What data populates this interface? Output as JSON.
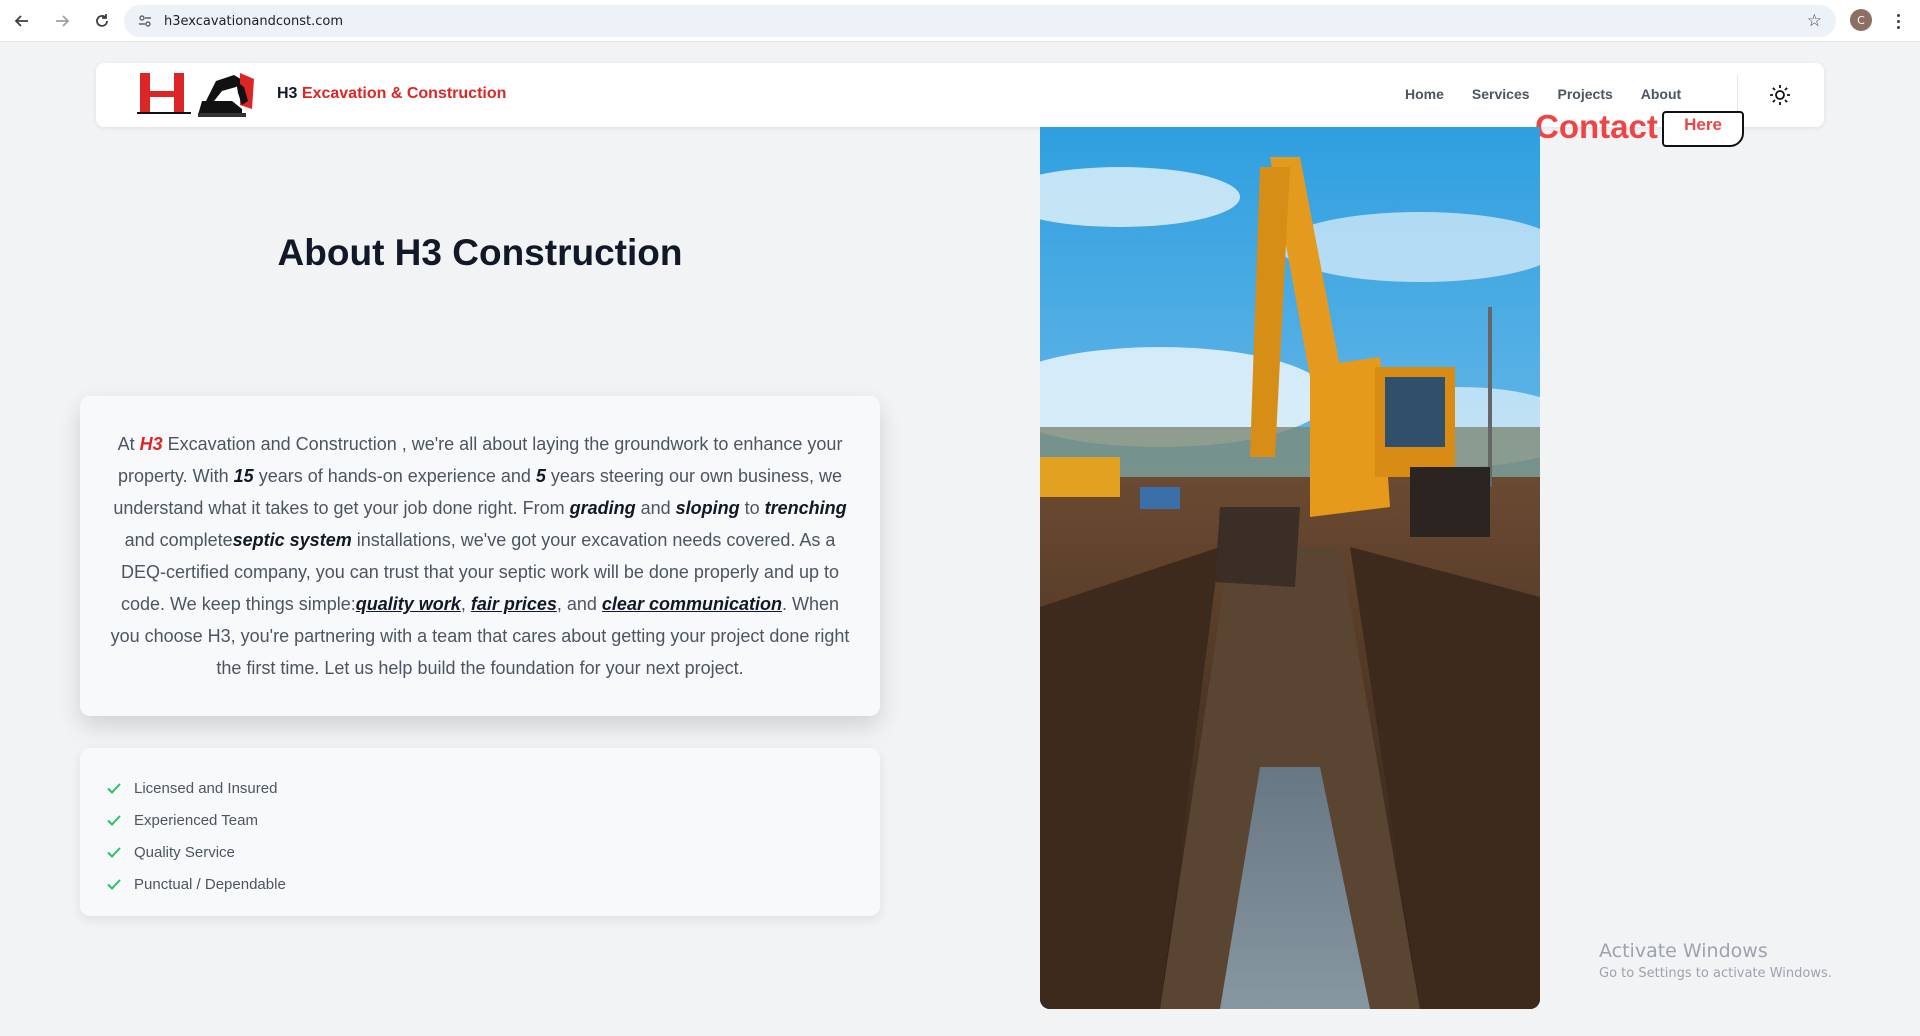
{
  "browser": {
    "url": "h3excavationandconst.com",
    "profile_initial": "C",
    "icons": [
      "back-icon",
      "forward-icon",
      "reload-icon",
      "site-info-icon",
      "star-icon",
      "menu-kebab-icon"
    ]
  },
  "header": {
    "brand_prefix": "H3",
    "brand_suffix": "Excavation & Construction",
    "nav": [
      "Home",
      "Services",
      "Projects",
      "About"
    ],
    "contact_label": "Contact",
    "here_label": "Here",
    "theme_icon": "sun-icon"
  },
  "about": {
    "title": "About H3 Construction",
    "intro_at": "At ",
    "brand": "H3",
    "t1": " Excavation and Construction , we're all about laying the groundwork to enhance your property. With ",
    "years_exp": "15",
    "t2": " years of hands-on experience and ",
    "years_biz": "5",
    "t3": " years steering our own business, we understand what it takes to get your job done right. From ",
    "grading": "grading",
    "t4": " and ",
    "sloping": "sloping",
    "t5": " to ",
    "trenching": "trenching",
    "t6": " and complete",
    "septic": "septic system",
    "t7": " installations, we've got your excavation needs covered. As a DEQ-certified company, you can trust that your septic work will be done properly and up to code. We keep things simple:",
    "quality": "quality work",
    "comma1": ", ",
    "fair": "fair prices",
    "t8": ", and ",
    "clear": "clear communication",
    "t9": ". When you choose H3, you're partnering with a team that cares about getting your project done right the first time. Let us help build the foundation for your next project."
  },
  "features": [
    "Licensed and Insured",
    "Experienced Team",
    "Quality Service",
    "Punctual / Dependable"
  ],
  "colors": {
    "accent": "#dc2626",
    "check": "#22c55e"
  },
  "os_overlay": {
    "line1": "Activate Windows",
    "line2": "Go to Settings to activate Windows."
  }
}
